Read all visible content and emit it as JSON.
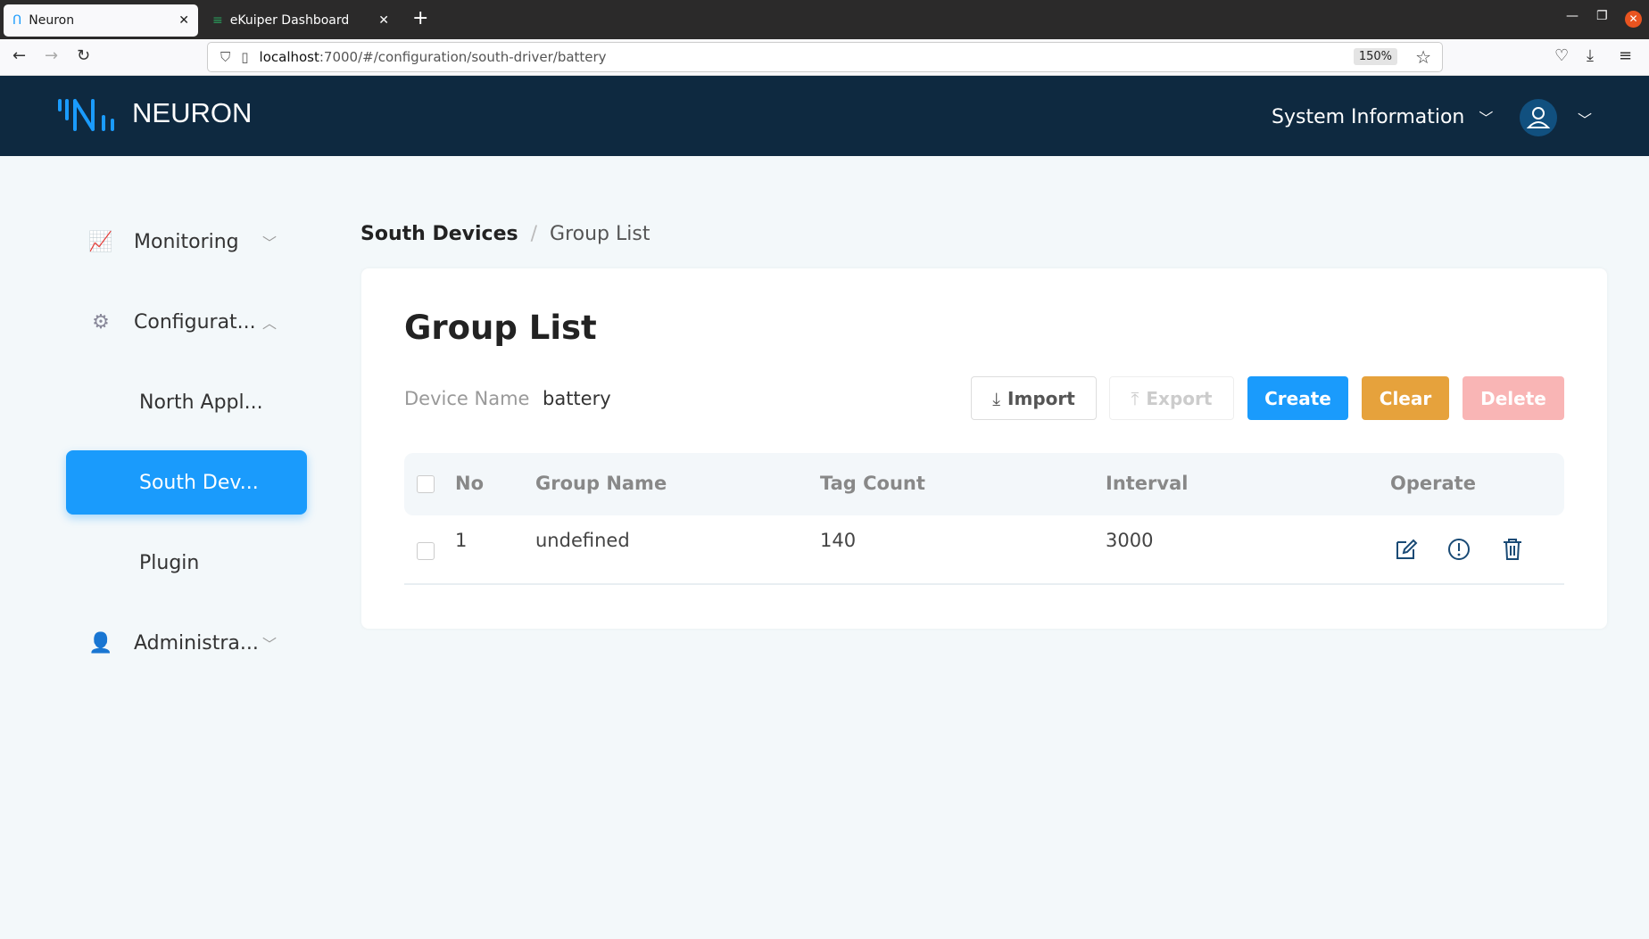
{
  "browser": {
    "tabs": [
      {
        "title": "Neuron",
        "active": true
      },
      {
        "title": "eKuiper Dashboard",
        "active": false
      }
    ],
    "url_host": "localhost",
    "url_path": ":7000/#/configuration/south-driver/battery",
    "zoom": "150%"
  },
  "header": {
    "brand": "NEURON",
    "system_info": "System Information"
  },
  "sidebar": {
    "items": [
      {
        "label": "Monitoring"
      },
      {
        "label": "Configurat..."
      },
      {
        "label": "North Appl..."
      },
      {
        "label": "South Dev..."
      },
      {
        "label": "Plugin"
      },
      {
        "label": "Administra..."
      }
    ]
  },
  "breadcrumb": {
    "parent": "South Devices",
    "separator": "/",
    "current": "Group List"
  },
  "main": {
    "title": "Group List",
    "device_label": "Device Name",
    "device_value": "battery",
    "buttons": {
      "import": "Import",
      "export": "Export",
      "create": "Create",
      "clear": "Clear",
      "delete": "Delete"
    },
    "colors": {
      "create": "#1a9bfc",
      "clear": "#e6a23c",
      "delete": "#f9b5b5"
    },
    "columns": [
      "No",
      "Group Name",
      "Tag Count",
      "Interval",
      "Operate"
    ],
    "rows": [
      {
        "no": "1",
        "group_name": "undefined",
        "tag_count": "140",
        "interval": "3000"
      }
    ]
  }
}
